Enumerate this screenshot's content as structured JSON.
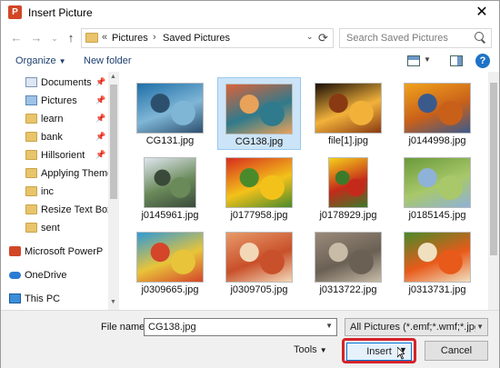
{
  "window": {
    "title": "Insert Picture",
    "app_icon_letter": "P",
    "close_glyph": "✕"
  },
  "nav": {
    "back_glyph": "←",
    "forward_glyph": "→",
    "recent_glyph": "⌄",
    "up_glyph": "↑",
    "address": {
      "prefix": "«",
      "segments": [
        "Pictures",
        "Saved Pictures"
      ],
      "separator": "›",
      "dropdown_glyph": "⌄",
      "refresh_glyph": "⟳"
    },
    "search_placeholder": "Search Saved Pictures"
  },
  "toolbar": {
    "organize_label": "Organize",
    "caret": "▼",
    "new_folder_label": "New folder",
    "help_glyph": "?"
  },
  "sidebar": {
    "items": [
      {
        "label": "Documents",
        "icon": "documents-icon",
        "pinned": true
      },
      {
        "label": "Pictures",
        "icon": "pictures-icon",
        "pinned": true
      },
      {
        "label": "learn",
        "icon": "folder-icon",
        "pinned": true
      },
      {
        "label": "bank",
        "icon": "folder-icon",
        "pinned": true
      },
      {
        "label": "Hillsorient",
        "icon": "folder-icon",
        "pinned": true
      },
      {
        "label": "Applying Theme",
        "icon": "folder-icon",
        "pinned": false
      },
      {
        "label": "inc",
        "icon": "folder-icon",
        "pinned": false
      },
      {
        "label": "Resize Text Boxes",
        "icon": "folder-icon",
        "pinned": false
      },
      {
        "label": "sent",
        "icon": "folder-icon",
        "pinned": false
      },
      {
        "label": "Microsoft PowerP",
        "icon": "powerpoint-icon",
        "pinned": false
      },
      {
        "label": "OneDrive",
        "icon": "onedrive-icon",
        "pinned": false
      },
      {
        "label": "This PC",
        "icon": "this-pc-icon",
        "pinned": false
      }
    ],
    "pin_glyph": "📌"
  },
  "files": [
    {
      "name": "CG131.jpg",
      "selected": false,
      "colors": [
        "#1f6fa8",
        "#7fb6d6",
        "#2d4f6e"
      ]
    },
    {
      "name": "CG138.jpg",
      "selected": true,
      "colors": [
        "#d9633a",
        "#2f7a8c",
        "#e8a25a"
      ]
    },
    {
      "name": "file[1].jpg",
      "selected": false,
      "colors": [
        "#1a0e08",
        "#f2b23a",
        "#8a3a12"
      ]
    },
    {
      "name": "j0144998.jpg",
      "selected": false,
      "colors": [
        "#f0a21c",
        "#c9601a",
        "#3b5a8c"
      ]
    },
    {
      "name": "j0145961.jpg",
      "selected": false,
      "colors": [
        "#dfe6ee",
        "#6a8a5a",
        "#3a4a3a"
      ]
    },
    {
      "name": "j0177958.jpg",
      "selected": false,
      "colors": [
        "#d72e1e",
        "#f3c21a",
        "#4a8a2a"
      ]
    },
    {
      "name": "j0178929.jpg",
      "selected": false,
      "colors": [
        "#f5d01a",
        "#c42a1a",
        "#3c7a2a"
      ]
    },
    {
      "name": "j0185145.jpg",
      "selected": false,
      "colors": [
        "#6a9a3a",
        "#a8c86a",
        "#8fb2d8"
      ]
    },
    {
      "name": "j0309665.jpg",
      "selected": false,
      "colors": [
        "#2f9ad6",
        "#e8c43a",
        "#d4452a"
      ]
    },
    {
      "name": "j0309705.jpg",
      "selected": false,
      "colors": [
        "#e89a6a",
        "#c8502a",
        "#f3d8b8"
      ]
    },
    {
      "name": "j0313722.jpg",
      "selected": false,
      "colors": [
        "#9a8a7a",
        "#6a6054",
        "#c8bca8"
      ]
    },
    {
      "name": "j0313731.jpg",
      "selected": false,
      "colors": [
        "#4a8a2a",
        "#e85a1a",
        "#f0e0c0"
      ]
    }
  ],
  "footer": {
    "file_name_label": "File name:",
    "file_name_value": "CG138.jpg",
    "filter_value": "All Pictures (*.emf;*.wmf;*.jpg;*",
    "tools_label": "Tools",
    "insert_label": "Insert",
    "cancel_label": "Cancel",
    "caret": "▼"
  }
}
